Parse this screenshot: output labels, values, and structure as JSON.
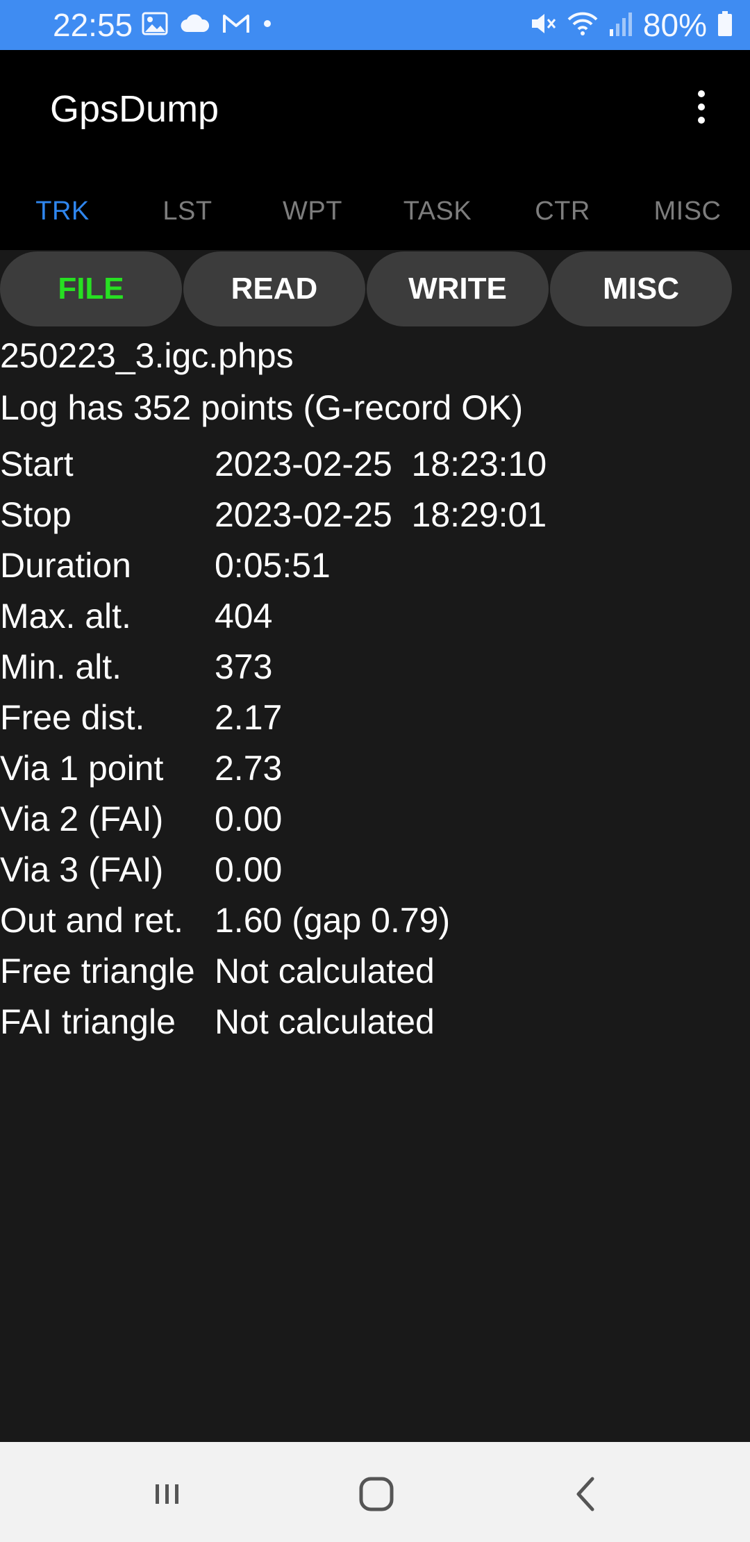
{
  "status_bar": {
    "time": "22:55",
    "battery": "80%",
    "left_icons": [
      "gallery-icon",
      "cloud-icon",
      "gmail-icon",
      "dot-icon"
    ],
    "right_icons": [
      "mute-icon",
      "wifi-icon",
      "signal-icon",
      "battery-icon"
    ]
  },
  "app_bar": {
    "title": "GpsDump",
    "menu_icon": "overflow-menu-icon"
  },
  "tabs": [
    {
      "label": "TRK",
      "active": true
    },
    {
      "label": "LST",
      "active": false
    },
    {
      "label": "WPT",
      "active": false
    },
    {
      "label": "TASK",
      "active": false
    },
    {
      "label": "CTR",
      "active": false
    },
    {
      "label": "MISC",
      "active": false
    }
  ],
  "buttons": [
    {
      "label": "FILE",
      "active": true
    },
    {
      "label": "READ",
      "active": false
    },
    {
      "label": "WRITE",
      "active": false
    },
    {
      "label": "MISC",
      "active": false
    }
  ],
  "file": {
    "name": "250223_3.igc.phps",
    "summary": "Log has 352 points (G-record OK)"
  },
  "stats": [
    {
      "label": "Start",
      "value": "2023-02-25  18:23:10"
    },
    {
      "label": "Stop",
      "value": "2023-02-25  18:29:01"
    },
    {
      "label": "Duration",
      "value": "0:05:51"
    },
    {
      "label": "Max. alt.",
      "value": "404"
    },
    {
      "label": "Min. alt.",
      "value": "373"
    },
    {
      "label": "Free dist.",
      "value": "2.17"
    },
    {
      "label": "Via 1 point",
      "value": "2.73"
    },
    {
      "label": "Via 2 (FAI)",
      "value": "0.00"
    },
    {
      "label": "Via 3 (FAI)",
      "value": "0.00"
    },
    {
      "label": "Out and ret.",
      "value": "1.60 (gap 0.79)"
    },
    {
      "label": "Free triangle",
      "value": "Not calculated"
    },
    {
      "label": "FAI triangle",
      "value": "Not calculated"
    }
  ],
  "nav_bar": {
    "buttons": [
      "recent-apps-icon",
      "home-icon",
      "back-icon"
    ]
  },
  "colors": {
    "status_bar": "#3f8cf2",
    "app_bar": "#000000",
    "content_bg": "#191919",
    "tab_active": "#2f86ee",
    "tab_inactive": "#7d7d7d",
    "button_bg": "#3c3c3c",
    "button_active_text": "#27e022",
    "nav_bar_bg": "#f2f2f2"
  }
}
